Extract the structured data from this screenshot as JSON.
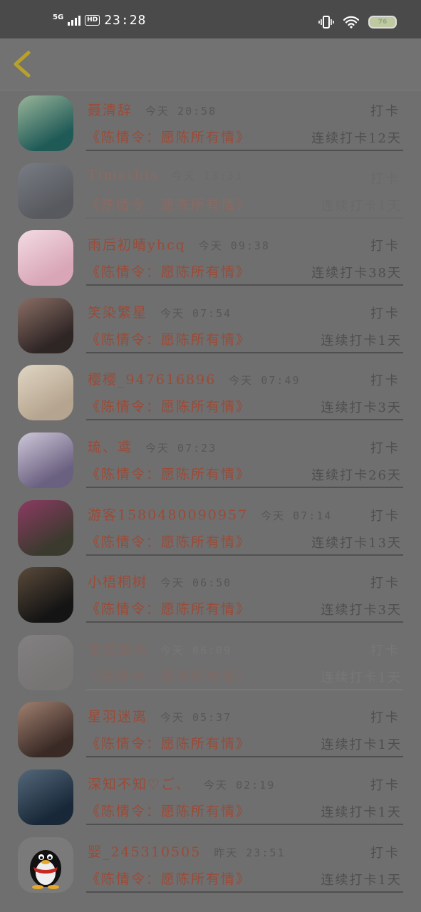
{
  "status_bar": {
    "signal": "5G",
    "hd": "HD",
    "time": "23:28",
    "battery": "76"
  },
  "header": {
    "back_icon": "chevron-left-icon",
    "back_color": "#b7a12a"
  },
  "entries": [
    {
      "name": "聂清辞",
      "time": "今天 20:58",
      "action": "打卡",
      "book": "《陈情令：愿陈所有情》",
      "streak": "连续打卡12天",
      "avatar_colors": [
        "#1f5a57",
        "#9ab59a"
      ]
    },
    {
      "name": "Timethis",
      "time": "今天 13:33",
      "action": "打卡",
      "book": "《陈情令：愿陈所有情》",
      "streak": "连续打卡1天",
      "avatar_colors": [
        "#2b3140",
        "#8894aa"
      ]
    },
    {
      "name": "雨后初晴yhcq",
      "time": "今天 09:38",
      "action": "打卡",
      "book": "《陈情令：愿陈所有情》",
      "streak": "连续打卡38天",
      "avatar_colors": [
        "#d9a6b7",
        "#f2dbe3"
      ]
    },
    {
      "name": "笑染繁星",
      "time": "今天 07:54",
      "action": "打卡",
      "book": "《陈情令：愿陈所有情》",
      "streak": "连续打卡1天",
      "avatar_colors": [
        "#2e2525",
        "#8a6e64"
      ]
    },
    {
      "name": "樱樱_947616896",
      "time": "今天 07:49",
      "action": "打卡",
      "book": "《陈情令：愿陈所有情》",
      "streak": "连续打卡3天",
      "avatar_colors": [
        "#b5a48f",
        "#e0d6c4"
      ]
    },
    {
      "name": "琉、鸢",
      "time": "今天 07:23",
      "action": "打卡",
      "book": "《陈情令：愿陈所有情》",
      "streak": "连续打卡26天",
      "avatar_colors": [
        "#6a6080",
        "#cfc8da"
      ]
    },
    {
      "name": "游客1580480090957",
      "time": "今天 07:14",
      "action": "打卡",
      "book": "《陈情令：愿陈所有情》",
      "streak": "连续打卡13天",
      "avatar_colors": [
        "#3a3a2e",
        "#8c3a62"
      ]
    },
    {
      "name": "小梧桐树",
      "time": "今天 06:50",
      "action": "打卡",
      "book": "《陈情令：愿陈所有情》",
      "streak": "连续打卡3天",
      "avatar_colors": [
        "#141414",
        "#5a4a3a"
      ]
    },
    {
      "name": "南笙墨染",
      "time": "今天 06:09",
      "action": "打卡",
      "book": "《陈情令：愿陈所有情》",
      "streak": "连续打卡1天",
      "avatar_colors": [
        "#9a8c88",
        "#d7cfcc"
      ]
    },
    {
      "name": "星羽迷离",
      "time": "今天 05:37",
      "action": "打卡",
      "book": "《陈情令：愿陈所有情》",
      "streak": "连续打卡1天",
      "avatar_colors": [
        "#3a2a26",
        "#a08070"
      ]
    },
    {
      "name": "深知不知♡ご、",
      "time": "今天 02:19",
      "action": "打卡",
      "book": "《陈情令：愿陈所有情》",
      "streak": "连续打卡1天",
      "avatar_colors": [
        "#182838",
        "#54687a"
      ]
    },
    {
      "name": "婴_245310505",
      "time": "昨天 23:51",
      "action": "打卡",
      "book": "《陈情令：愿陈所有情》",
      "streak": "连续打卡1天",
      "avatar_colors": [
        "#7a7a7a",
        "#7a7a7a"
      ]
    }
  ]
}
